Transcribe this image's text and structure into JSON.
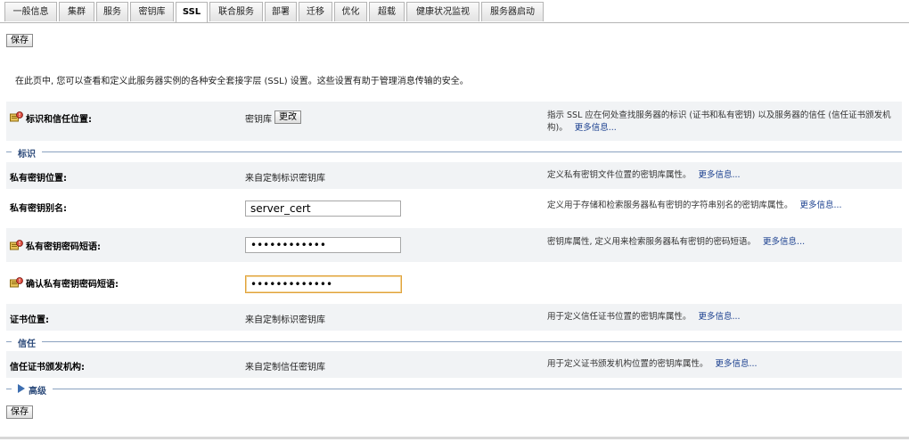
{
  "tabs": [
    "一般信息",
    "集群",
    "服务",
    "密钥库",
    "SSL",
    "联合服务",
    "部署",
    "迁移",
    "优化",
    "超载",
    "健康状况监视",
    "服务器启动"
  ],
  "active_tab": "SSL",
  "save_label": "保存",
  "intro": "在此页中, 您可以查看和定义此服务器实例的各种安全套接字层 (SSL) 设置。这些设置有助于管理消息传输的安全。",
  "identity_trust": {
    "label": "标识和信任位置:",
    "value": "密钥库",
    "change_button": "更改",
    "desc": "指示 SSL 应在何处查找服务器的标识 (证书和私有密钥) 以及服务器的信任 (信任证书颁发机构)。",
    "more": "更多信息..."
  },
  "sections": {
    "identity": "标识",
    "trust": "信任",
    "advanced": "高级"
  },
  "private_key_location": {
    "label": "私有密钥位置:",
    "value": "来自定制标识密钥库",
    "desc": "定义私有密钥文件位置的密钥库属性。",
    "more": "更多信息..."
  },
  "private_key_alias": {
    "label": "私有密钥别名:",
    "value": "server_cert",
    "desc": "定义用于存储和检索服务器私有密钥的字符串别名的密钥库属性。",
    "more": "更多信息..."
  },
  "private_key_pass": {
    "label": "私有密钥密码短语:",
    "value": "••••••••••••",
    "desc": "密钥库属性, 定义用来检索服务器私有密钥的密码短语。",
    "more": "更多信息..."
  },
  "confirm_pass": {
    "label": "确认私有密钥密码短语:",
    "value": "•••••••••••••"
  },
  "cert_location": {
    "label": "证书位置:",
    "value": "来自定制标识密钥库",
    "desc": "用于定义信任证书位置的密钥库属性。",
    "more": "更多信息..."
  },
  "trusted_ca": {
    "label": "信任证书颁发机构:",
    "value": "来自定制信任密钥库",
    "desc": "用于定义证书颁发机构位置的密钥库属性。",
    "more": "更多信息..."
  }
}
